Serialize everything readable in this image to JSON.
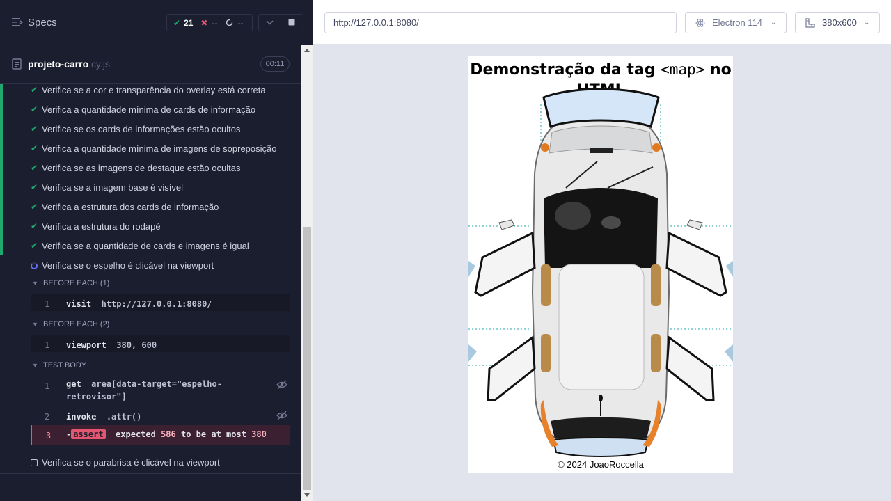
{
  "reporter": {
    "title": "Specs",
    "stats": {
      "passed": "21",
      "failed": "--",
      "pending": "--"
    },
    "spec": {
      "name": "projeto-carro",
      "ext": ".cy.js",
      "duration": "00:11"
    },
    "tests": [
      {
        "label": "Verifica se a cor e transparência do overlay está correta",
        "state": "passed"
      },
      {
        "label": "Verifica a quantidade mínima de cards de informação",
        "state": "passed"
      },
      {
        "label": "Verifica se os cards de informações estão ocultos",
        "state": "passed"
      },
      {
        "label": "Verifica a quantidade mínima de imagens de sopreposição",
        "state": "passed"
      },
      {
        "label": "Verifica se as imagens de destaque estão ocultas",
        "state": "passed"
      },
      {
        "label": "Verifica se a imagem base é visível",
        "state": "passed"
      },
      {
        "label": "Verifica a estrutura dos cards de informação",
        "state": "passed"
      },
      {
        "label": "Verifica a estrutura do rodapé",
        "state": "passed"
      },
      {
        "label": "Verifica se a quantidade de cards e imagens é igual",
        "state": "passed"
      },
      {
        "label": "Verifica se o espelho é clicável na viewport",
        "state": "running"
      },
      {
        "label": "Verifica se o parabrisa é clicável na viewport",
        "state": "pending"
      }
    ],
    "hooks": {
      "before_each_1": {
        "title": "BEFORE EACH (1)",
        "num": "1",
        "name": "visit",
        "msg": "http://127.0.0.1:8080/"
      },
      "before_each_2": {
        "title": "BEFORE EACH (2)",
        "num": "1",
        "name": "viewport",
        "msg": "380, 600"
      },
      "test_body": {
        "title": "TEST BODY",
        "cmd1": {
          "num": "1",
          "name": "get",
          "msg_line1": "area[data-target=\"espelho-",
          "msg_line2": "retrovisor\"]"
        },
        "cmd2": {
          "num": "2",
          "name": "invoke",
          "msg": ".attr()"
        },
        "cmd3": {
          "num": "3",
          "name_prefix": "-",
          "name": "assert",
          "msg_a": "expected",
          "val1": "586",
          "msg_b": "to be at most",
          "val2": "380"
        }
      }
    }
  },
  "aut": {
    "url": "http://127.0.0.1:8080/",
    "browser": "Electron 114",
    "viewport": "380x600",
    "page": {
      "title_before": "Demonstração da tag ",
      "title_code": "<map>",
      "title_after": " no HTML",
      "footer": "© 2024 JoaoRoccella"
    }
  },
  "colors": {
    "pass": "#1fa971",
    "fail": "#e45770",
    "running": "#6470f3",
    "panel_bg": "#1b1e2e"
  }
}
